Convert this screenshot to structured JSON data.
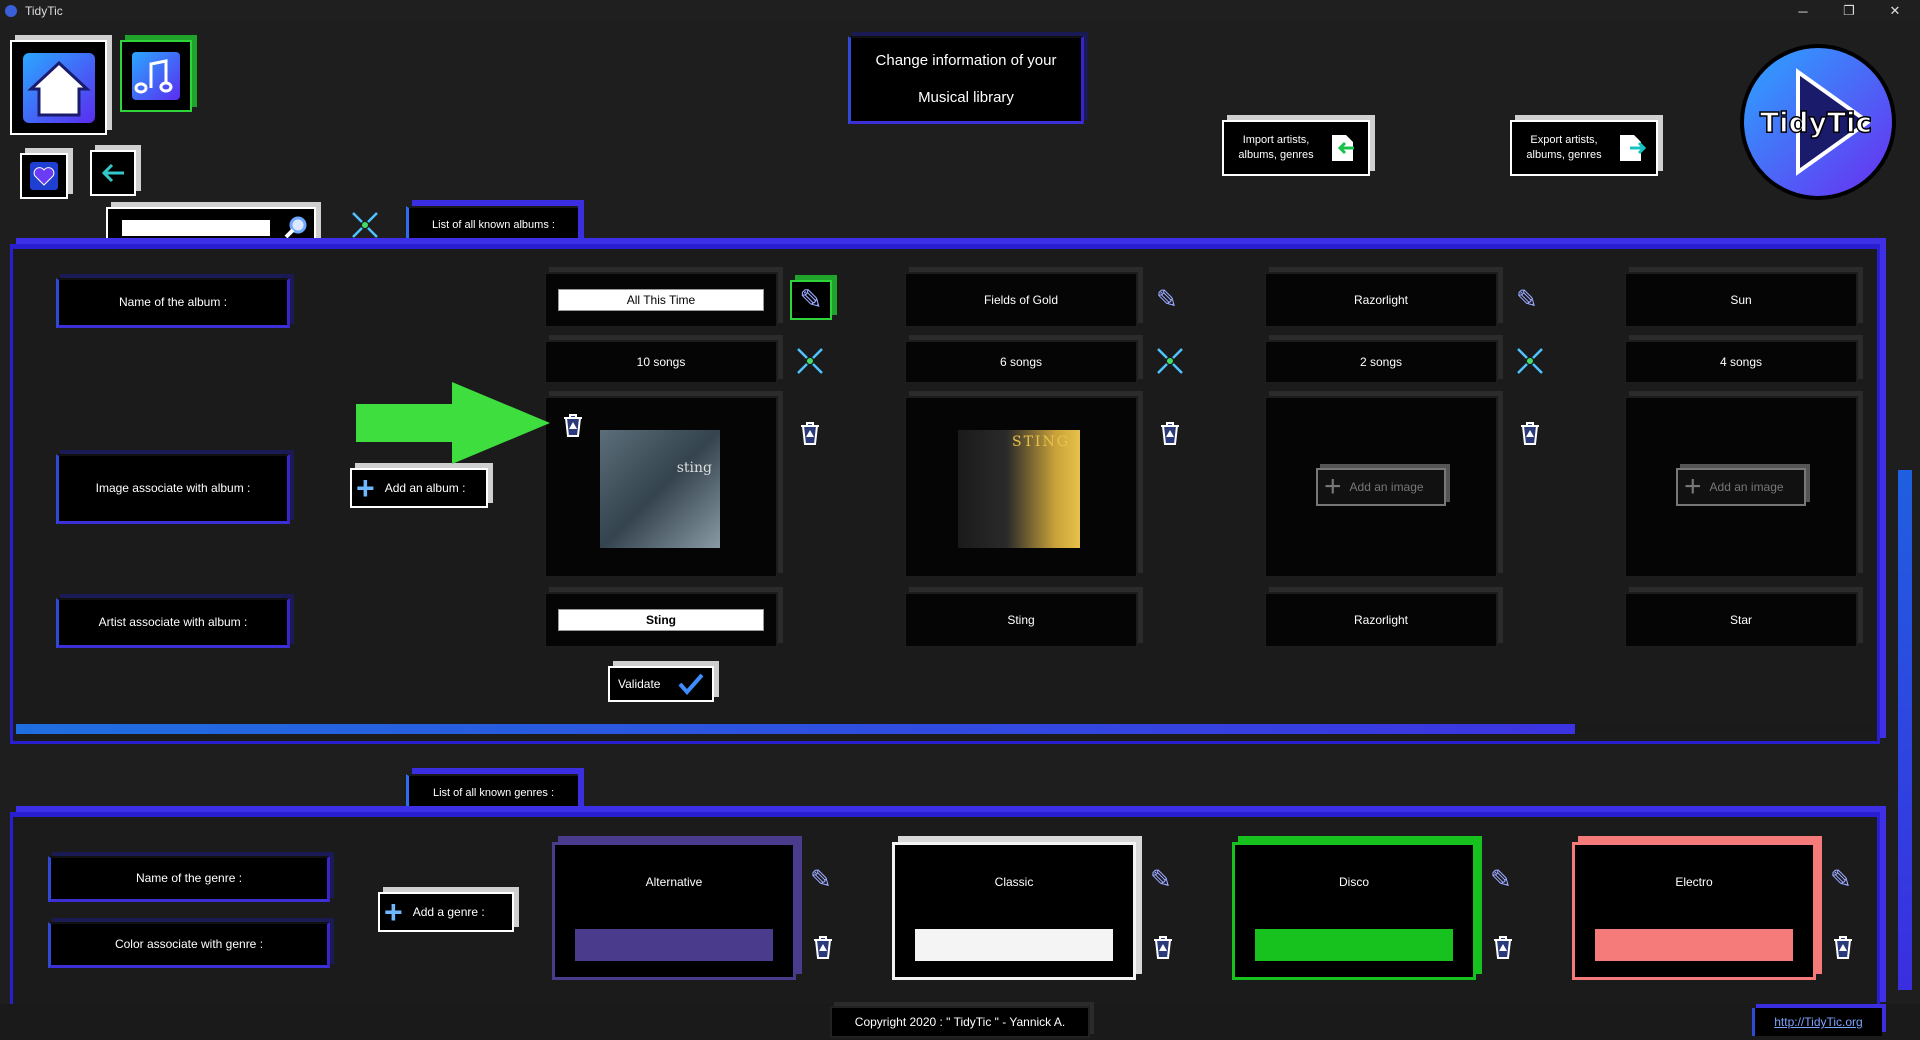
{
  "window": {
    "title": "TidyTic",
    "minimize": "─",
    "restore": "❐",
    "close": "✕"
  },
  "header": {
    "center_title_line1": "Change information of your",
    "center_title_line2": "Musical library",
    "import_label": "Import artists, albums, genres",
    "export_label": "Export artists, albums, genres",
    "logo_text": "TidyTic"
  },
  "search": {
    "value": "",
    "placeholder": ""
  },
  "albums_section": {
    "tab_label": "List of all known albums :",
    "row_labels": {
      "name": "Name of the album :",
      "image": "Image associate with album :",
      "artist": "Artist associate with album :"
    },
    "add_album_label": "Add an album :",
    "validate_label": "Validate",
    "add_image_label": "Add an image",
    "albums": [
      {
        "name": "All This Time",
        "songs": "10 songs",
        "artist": "Sting",
        "editing": true,
        "cover_text": "sting"
      },
      {
        "name": "Fields of Gold",
        "songs": "6 songs",
        "artist": "Sting",
        "editing": false,
        "cover_text": "STING"
      },
      {
        "name": "Razorlight",
        "songs": "2 songs",
        "artist": "Razorlight",
        "editing": false
      },
      {
        "name": "Sun",
        "songs": "4 songs",
        "artist": "Star",
        "editing": false
      }
    ],
    "scroll_position": 0.84
  },
  "genres_section": {
    "tab_label": "List of all known genres :",
    "row_labels": {
      "name": "Name of the genre :",
      "color": "Color associate with genre :"
    },
    "add_genre_label": "Add a genre :",
    "genres": [
      {
        "name": "Alternative",
        "color": "#4a3b8c"
      },
      {
        "name": "Classic",
        "color": "#f4f4f4"
      },
      {
        "name": "Disco",
        "color": "#17c21e"
      },
      {
        "name": "Electro",
        "color": "#f57a7a"
      }
    ]
  },
  "footer": {
    "copyright": "Copyright 2020 : \" TidyTic \" - Yannick A.",
    "link": "http://TidyTic.org"
  },
  "colors": {
    "accent": "#3b2ee0",
    "highlight_arrow": "#3fde3f"
  }
}
